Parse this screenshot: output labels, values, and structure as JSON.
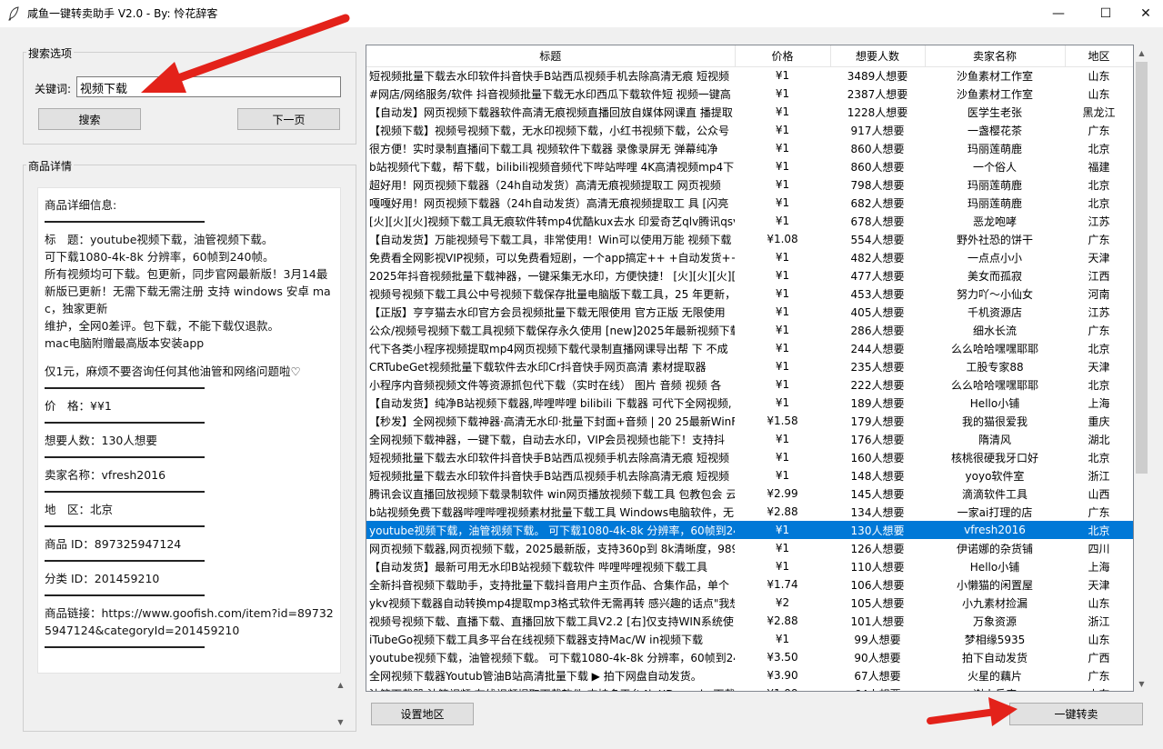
{
  "window": {
    "title": "咸鱼一键转卖助手 V2.0 - By: 怜花辞客",
    "minimize": "—",
    "maximize": "☐",
    "close": "✕"
  },
  "search": {
    "group_label": "搜索选项",
    "keyword_label": "关键词:",
    "keyword_value": "视频下载",
    "search_button": "搜索",
    "next_page_button": "下一页"
  },
  "details": {
    "group_label": "商品详情",
    "header": "商品详细信息:",
    "title_line": "标　题：youtube视频下载，油管视频下载。",
    "desc_lines": [
      "可下载1080-4k-8k 分辨率，60帧到240帧。",
      "所有视频均可下载。包更新，同步官网最新版！3月14最新版已更新！无需下载无需注册  支持 windows  安卓 mac，独家更新",
      "维护，全网0差评。包下载，不能下载仅退款。",
      "mac电脑附赠最高版本安装app"
    ],
    "note": "仅1元，麻烦不要咨询任何其他油管和网络问题啦♡",
    "price": "价　格：¥¥1",
    "wants": "想要人数：130人想要",
    "seller": "卖家名称：vfresh2016",
    "region": "地　区：北京",
    "item_id": "商品 ID：897325947124",
    "category_id": "分类 ID：201459210",
    "link": "商品链接：https://www.goofish.com/item?id=897325947124&categoryId=201459210"
  },
  "table": {
    "columns": [
      "标题",
      "价格",
      "想要人数",
      "卖家名称",
      "地区"
    ],
    "selected_index": 25,
    "rows": [
      [
        "短视频批量下载去水印软件抖音快手B站西瓜视频手机去除高清无痕 短视频",
        "¥1",
        "3489人想要",
        "沙鱼素材工作室",
        "山东"
      ],
      [
        "#网店/网络服务/软件 抖音视频批量下载无水印西瓜下载软件短 视频一键高",
        "¥1",
        "2387人想要",
        "沙鱼素材工作室",
        "山东"
      ],
      [
        "【自动发】网页视频下载器软件高清无痕视频直播回放自媒体网课直 播提取",
        "¥1",
        "1228人想要",
        "医学生老张",
        "黑龙江"
      ],
      [
        "【视频下载】视频号视频下载，无水印视频下载，小红书视频下载，公众号",
        "¥1",
        "917人想要",
        "一盏樱花茶",
        "广东"
      ],
      [
        "很方便！实时录制直播间下载工具  视频软件下载器 录像录屏无 弹幕纯净",
        "¥1",
        "860人想要",
        "玛丽莲萌鹿",
        "北京"
      ],
      [
        "b站视频代下载，帮下载，bilibili视频音频代下哔站哔哩 4K高清视频mp4下",
        "¥1",
        "860人想要",
        "一个俗人",
        "福建"
      ],
      [
        "超好用！网页视频下载器（24h自动发货）高清无痕视频提取工 网页视频",
        "¥1",
        "798人想要",
        "玛丽莲萌鹿",
        "北京"
      ],
      [
        "嘎嘎好用！网页视频下载器（24h自动发货）高清无痕视频提取工 具 [闪亮",
        "¥1",
        "682人想要",
        "玛丽莲萌鹿",
        "北京"
      ],
      [
        "[火][火][火]视频下载工具无痕软件转mp4优酷kux去水 印爱奇艺qlv腾讯qsv",
        "¥1",
        "678人想要",
        "恶龙咆哮",
        "江苏"
      ],
      [
        "【自动发货】万能视频号下载工具，非常使用！Win可以使用万能 视频下载",
        "¥1.08",
        "554人想要",
        "野外社恐的饼干",
        "广东"
      ],
      [
        "免费看全网影视VIP视频，可以免费看短剧，一个app搞定++ +自动发货++",
        "¥1",
        "482人想要",
        "一点点小小",
        "天津"
      ],
      [
        "2025年抖音视频批量下载神器，一键采集无水印，方便快捷！ [火][火][火][",
        "¥1",
        "477人想要",
        "美女而孤寂",
        "江西"
      ],
      [
        "视频号视频下载工具公中号视频下载保存批量电脑版下载工具，25 年更新，",
        "¥1",
        "453人想要",
        "努力吖～小仙女",
        "河南"
      ],
      [
        "【正版】亨亨猫去水印官方会员视频批量下载无限使用 官方正版  无限使用",
        "¥1",
        "405人想要",
        "千机资源店",
        "江苏"
      ],
      [
        "公众/视频号视频下载工具视频下载保存永久使用 [new]2025年最新视频下载",
        "¥1",
        "286人想要",
        "细水长流",
        "广东"
      ],
      [
        "代下各类小程序视频提取mp4网页视频下载代录制直播网课导出帮 下  不成",
        "¥1",
        "244人想要",
        "么么哈哈嘿嘿耶耶",
        "北京"
      ],
      [
        "CRTubeGet视频批量下载软件去水印Cr抖音快手网页高清 素材提取器",
        "¥1",
        "235人想要",
        "工股专家88",
        "天津"
      ],
      [
        "小程序内音频视频文件等资源抓包代下载（实时在线） 图片  音频  视频  各",
        "¥1",
        "222人想要",
        "么么哈哈嘿嘿耶耶",
        "北京"
      ],
      [
        "【自动发货】纯净B站视频下载器,哔哩哔哩 bilibili 下载器 可代下全网视频,",
        "¥1",
        "189人想要",
        "Hello小铺",
        "上海"
      ],
      [
        "【秒发】全网视频下载神器·高清无水印·批量下封面+音频 | 20 25最新WinF",
        "¥1.58",
        "179人想要",
        "我的猫很爱我",
        "重庆"
      ],
      [
        "全网视频下载神器，一键下载，自动去水印，VIP会员视频也能下！支持抖",
        "¥1",
        "176人想要",
        "隋清风",
        "湖北"
      ],
      [
        "短视频批量下载去水印软件抖音快手B站西瓜视频手机去除高清无痕 短视频",
        "¥1",
        "160人想要",
        "核桃很硬我牙口好",
        "北京"
      ],
      [
        "短视频批量下载去水印软件抖音快手B站西瓜视频手机去除高清无痕 短视频",
        "¥1",
        "148人想要",
        "yoyo软件室",
        "浙江"
      ],
      [
        "腾讯会议直播回放视频下载录制软件 win网页播放视频下载工具 包教包会 云",
        "¥2.99",
        "145人想要",
        "滴滴软件工具",
        "山西"
      ],
      [
        "b站视频免费下载器哔哩哔哩视频素材批量下载工具 Windows电脑软件，无",
        "¥2.88",
        "134人想要",
        "一家ai打理的店",
        "广东"
      ],
      [
        "youtube视频下载，油管视频下载。 可下载1080-4k-8k 分辨率，60帧到240",
        "¥1",
        "130人想要",
        "vfresh2016",
        "北京"
      ],
      [
        "网页视频下载器,网页视频下载，2025最新版，支持360p到 8k清晰度，989",
        "¥1",
        "126人想要",
        "伊诺娜的杂货铺",
        "四川"
      ],
      [
        "【自动发货】最新可用无水印B站视频下载软件 哔哩哔哩视频下载工具",
        "¥1",
        "110人想要",
        "Hello小铺",
        "上海"
      ],
      [
        "全新抖音视频下载助手，支持批量下载抖音用户主页作品、合集作品，单个",
        "¥1.74",
        "106人想要",
        "小懒猫的闲置屋",
        "天津"
      ],
      [
        "ykv视频下载器自动转换mp4提取mp3格式软件无需再转 感兴趣的话点\"我想",
        "¥2",
        "105人想要",
        "小九素材捡漏",
        "山东"
      ],
      [
        "视频号视频下载、直播下载、直播回放下载工具V2.2 [右]仅支持WIN系统使",
        "¥2.88",
        "101人想要",
        "万象资源",
        "浙江"
      ],
      [
        "   iTubeGo视频下载工具多平台在线视频下载器支持Mac/W in视频下载",
        "¥1",
        "99人想要",
        "梦相缘5935",
        "山东"
      ],
      [
        "youtube视频下载，油管视频下载。 可下载1080-4k-8k 分辨率，60帧到240",
        "¥3.50",
        "90人想要",
        "拍下自动发货",
        "广西"
      ],
      [
        "全网视频下载器Youtub管油B站高清批量下载 ▶ 拍下网盘自动发货。",
        "¥3.90",
        "67人想要",
        "火星的藕片",
        "广东"
      ],
      [
        "油管下载器 油管视频 在线视频提取下载软件 支持多平台4k XDown lo 下载器",
        "¥1.99",
        "64人想要",
        "谢小兵店",
        "山东"
      ]
    ]
  },
  "bottom": {
    "set_region_button": "设置地区",
    "one_click_resell_button": "一键转卖"
  }
}
